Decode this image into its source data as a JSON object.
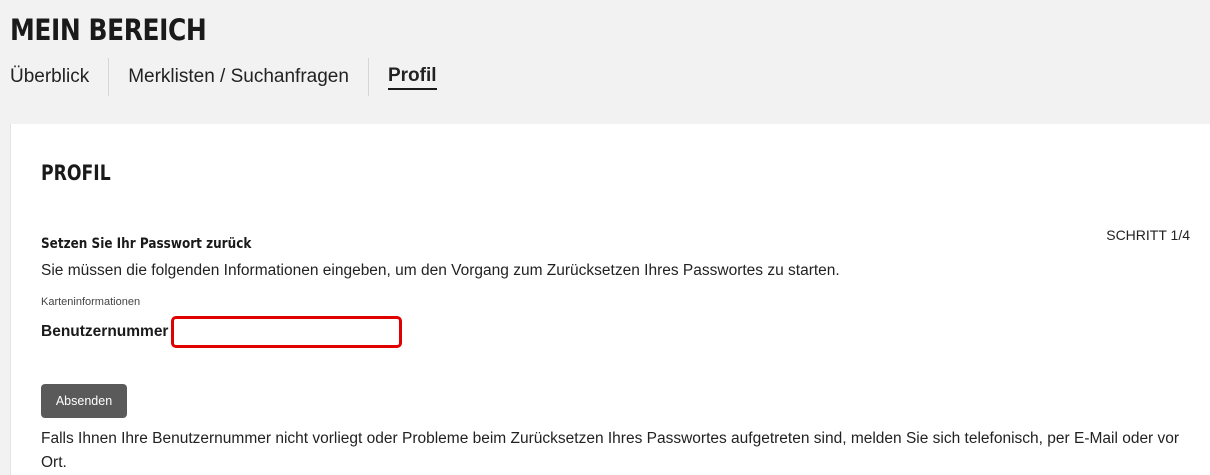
{
  "header": {
    "title": "MEIN BEREICH",
    "tabs": [
      {
        "label": "Überblick"
      },
      {
        "label": "Merklisten / Suchanfragen"
      },
      {
        "label": "Profil",
        "active": true
      }
    ]
  },
  "panel": {
    "title": "PROFIL",
    "step": "SCHRITT 1/4",
    "reset_heading": "Setzen Sie Ihr Passwort zurück",
    "intro": "Sie müssen die folgenden Informationen eingeben, um den Vorgang zum Zurücksetzen Ihres Passwortes zu starten.",
    "card_info_label": "Karteninformationen",
    "user_number_label": "Benutzernummer",
    "user_number_value": "",
    "submit_label": "Absenden",
    "help_text": "Falls Ihnen Ihre Benutzernummer nicht vorliegt oder Probleme beim Zurücksetzen Ihres Passwortes aufgetreten sind, melden Sie sich telefonisch, per E-Mail oder vor Ort."
  },
  "colors": {
    "highlight_border": "#e00000",
    "button_bg": "#5a5a5a",
    "header_bg": "#f2f2f2"
  }
}
